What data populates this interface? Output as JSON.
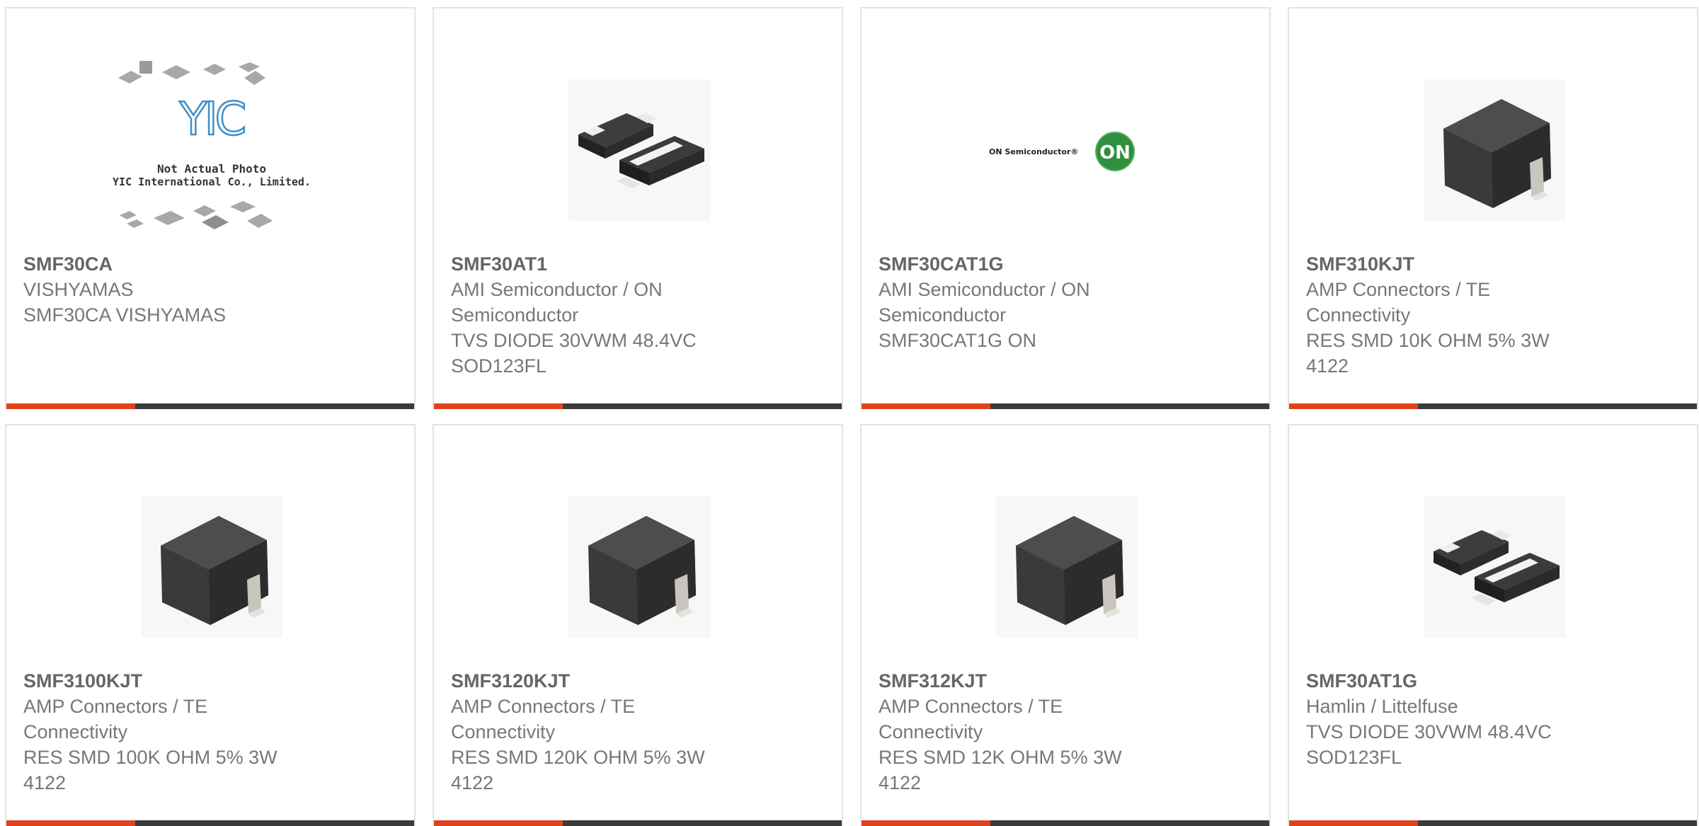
{
  "colors": {
    "accent": "#e0431c",
    "bar": "#3b3b3b",
    "border": "#e3e3e3",
    "text": "#777777"
  },
  "products": [
    {
      "part_number": "SMF30CA",
      "manufacturer": "VISHYAMAS",
      "description": "SMF30CA VISHYAMAS",
      "image": "yic-placeholder-image",
      "placeholder": {
        "logo": "YIC",
        "line1": "Not Actual Photo",
        "line2": "YIC International Co., Limited."
      }
    },
    {
      "part_number": "SMF30AT1",
      "manufacturer": "AMI Semiconductor / ON Semiconductor",
      "description": "TVS DIODE 30VWM 48.4VC SOD123FL",
      "image": "sod123-diode-image"
    },
    {
      "part_number": "SMF30CAT1G",
      "manufacturer": "AMI Semiconductor / ON Semiconductor",
      "description": "SMF30CAT1G ON",
      "image": "on-semiconductor-logo",
      "logo": {
        "brand": "ON Semiconductor®",
        "mark": "ON"
      }
    },
    {
      "part_number": "SMF310KJT",
      "manufacturer": "AMP Connectors / TE Connectivity",
      "description": "RES SMD 10K OHM 5% 3W 4122",
      "image": "resistor-package-image"
    },
    {
      "part_number": "SMF3100KJT",
      "manufacturer": "AMP Connectors / TE Connectivity",
      "description": "RES SMD 100K OHM 5% 3W 4122",
      "image": "resistor-package-image"
    },
    {
      "part_number": "SMF3120KJT",
      "manufacturer": "AMP Connectors / TE Connectivity",
      "description": "RES SMD 120K OHM 5% 3W 4122",
      "image": "resistor-package-image"
    },
    {
      "part_number": "SMF312KJT",
      "manufacturer": "AMP Connectors / TE Connectivity",
      "description": "RES SMD 12K OHM 5% 3W 4122",
      "image": "resistor-package-image"
    },
    {
      "part_number": "SMF30AT1G",
      "manufacturer": "Hamlin / Littelfuse",
      "description": "TVS DIODE 30VWM 48.4VC SOD123FL",
      "image": "sod123-diode-image"
    }
  ]
}
